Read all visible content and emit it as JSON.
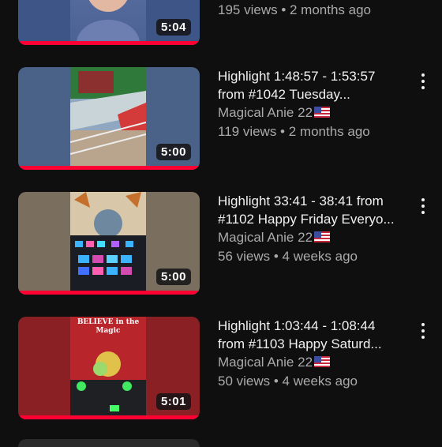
{
  "colors": {
    "background": "#0f0f0f",
    "progress": "#ff0033",
    "text": "#f1f1f1",
    "muted": "#aaaaaa"
  },
  "videos": [
    {
      "duration": "5:04",
      "title_line1": "",
      "title_line2": "",
      "channel": "",
      "stats": "195 views • 2 months ago",
      "watched_fraction": 1.0
    },
    {
      "duration": "5:00",
      "title_line1": "Highlight 1:48:57 - 1:53:57",
      "title_line2": "from #1042 Tuesday...",
      "channel": "Magical Anie 22",
      "stats": "119 views • 2 months ago",
      "watched_fraction": 1.0
    },
    {
      "duration": "5:00",
      "title_line1": "Highlight 33:41 - 38:41 from",
      "title_line2": "#1102 Happy Friday Everyo...",
      "channel": "Magical Anie 22",
      "stats": "56 views • 4 weeks ago",
      "watched_fraction": 1.0
    },
    {
      "duration": "5:01",
      "title_line1": "Highlight 1:03:44 - 1:08:44",
      "title_line2": "from #1103 Happy Saturd...",
      "channel": "Magical Anie 22",
      "stats": "50 views • 4 weeks ago",
      "watched_fraction": 1.0
    }
  ],
  "thumb4_text": "BELIEVE in the Magic",
  "icons": {
    "more": "more-vert-icon",
    "flag": "us-flag-icon"
  }
}
